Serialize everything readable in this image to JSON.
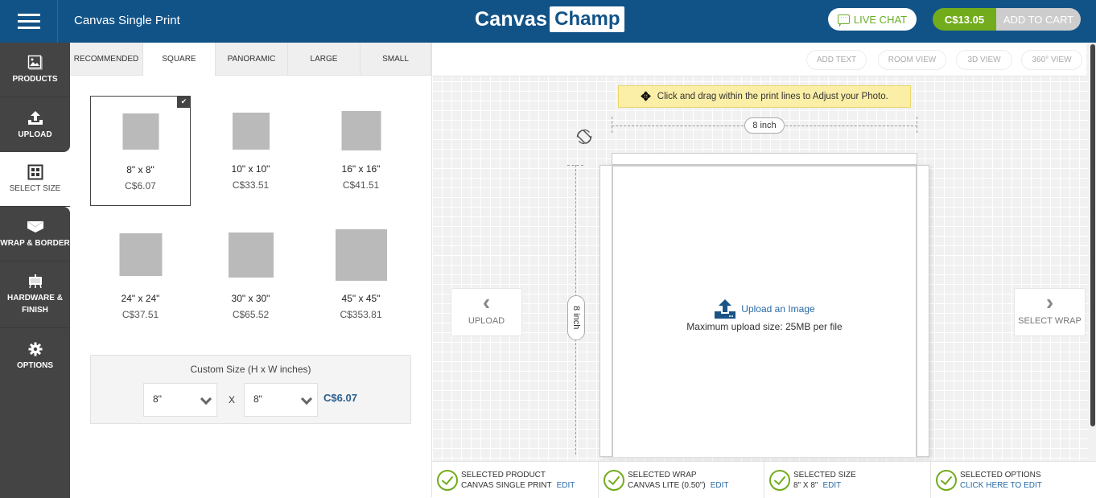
{
  "header": {
    "menu_icon": "hamburger-menu-icon",
    "app_title": "Canvas Single Print",
    "logo_part1": "Canvas",
    "logo_part2": "Champ",
    "live_chat_label": "LIVE CHAT",
    "cart_total": "C$13.05",
    "add_to_cart_label": "ADD TO CART",
    "colors": {
      "brand": "#125387",
      "accent_green": "#72ac1c"
    }
  },
  "sidebar": {
    "items": [
      {
        "label": "PRODUCTS",
        "icon": "image-stack-icon"
      },
      {
        "label": "UPLOAD",
        "icon": "upload-icon"
      },
      {
        "label": "SELECT SIZE",
        "icon": "grid-icon",
        "active": true
      },
      {
        "label": "WRAP & BORDER",
        "icon": "envelope-wrap-icon"
      },
      {
        "label": "HARDWARE & FINISH",
        "icon": "easel-icon"
      },
      {
        "label": "OPTIONS",
        "icon": "gear-icon"
      }
    ]
  },
  "size_panel": {
    "tabs": [
      {
        "label": "RECOMMENDED"
      },
      {
        "label": "SQUARE",
        "active": true
      },
      {
        "label": "PANORAMIC"
      },
      {
        "label": "LARGE"
      },
      {
        "label": "SMALL"
      }
    ],
    "sizes": [
      {
        "label": "8\" x 8\"",
        "price": "C$6.07",
        "selected": true
      },
      {
        "label": "10\" x 10\"",
        "price": "C$33.51"
      },
      {
        "label": "16\" x 16\"",
        "price": "C$41.51"
      },
      {
        "label": "24\" x 24\"",
        "price": "C$37.51"
      },
      {
        "label": "30\" x 30\"",
        "price": "C$65.52"
      },
      {
        "label": "45\" x 45\"",
        "price": "C$353.81"
      }
    ],
    "custom": {
      "title": "Custom Size (H x W inches)",
      "height_value": "8\"",
      "width_value": "8\"",
      "separator": "X",
      "price": "C$6.07"
    }
  },
  "canvas": {
    "view_buttons": [
      "ADD TEXT",
      "ROOM VIEW",
      "3D VIEW",
      "360° VIEW"
    ],
    "hint": "Click and drag within the print lines to Adjust your Photo.",
    "width_label": "8 inch",
    "height_label": "8 inch",
    "upload_link": "Upload an Image",
    "upload_max": "Maximum upload size: 25MB per file",
    "prev_button": "UPLOAD",
    "next_button": "SELECT WRAP"
  },
  "status_bar": [
    {
      "title": "SELECTED PRODUCT",
      "value": "CANVAS SINGLE PRINT",
      "edit": "EDIT"
    },
    {
      "title": "SELECTED WRAP",
      "value": "CANVAS LITE (0.50\")",
      "edit": "EDIT"
    },
    {
      "title": "SELECTED SIZE",
      "value": "8\" X 8\"",
      "edit": "EDIT"
    },
    {
      "title": "SELECTED OPTIONS",
      "value": "",
      "edit": "CLICK HERE TO EDIT"
    }
  ]
}
